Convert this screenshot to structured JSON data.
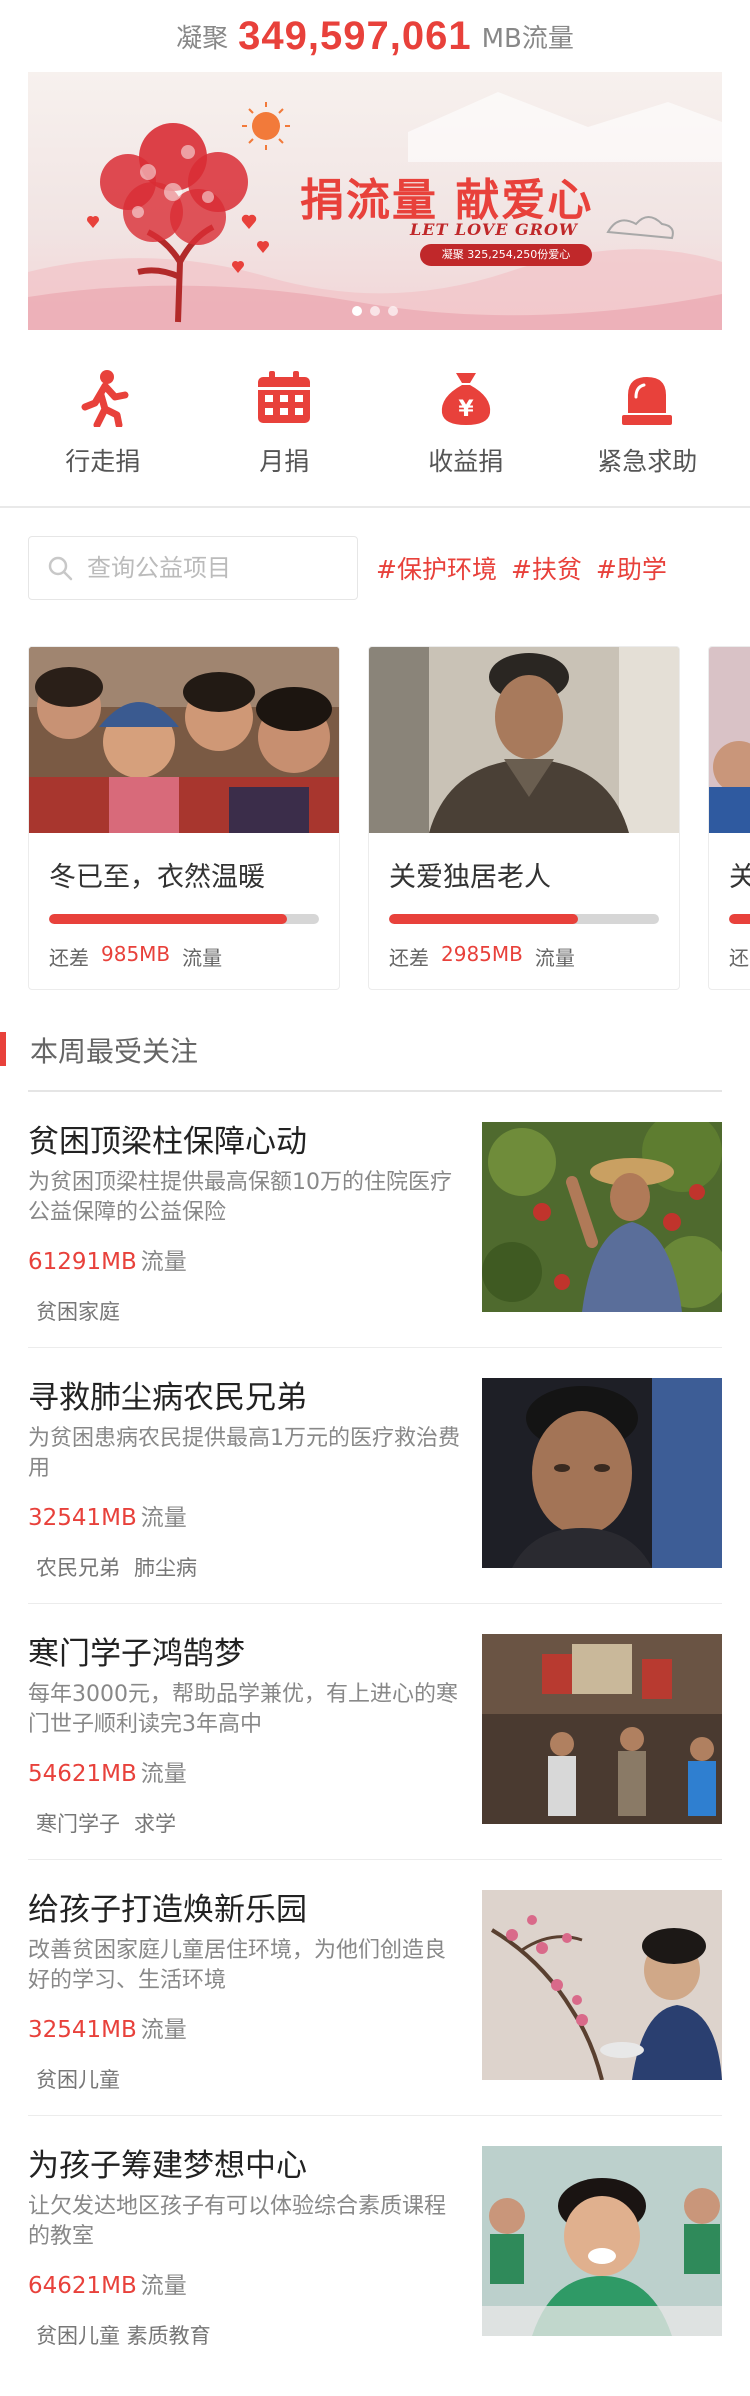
{
  "header": {
    "prefix": "凝聚",
    "total": "349,597,061",
    "unit": "MB流量"
  },
  "banner": {
    "title": "捐流量 献爱心",
    "subtitle": "LET LOVE GROW",
    "pill": "凝聚 325,254,250份爱心",
    "slide_count": 3,
    "active_slide": 1
  },
  "categories": [
    {
      "label": "行走捐",
      "icon": "walking-person-icon"
    },
    {
      "label": "月捐",
      "icon": "calendar-icon"
    },
    {
      "label": "收益捐",
      "icon": "money-bag-icon"
    },
    {
      "label": "紧急求助",
      "icon": "alarm-light-icon"
    }
  ],
  "search": {
    "placeholder": "查询公益项目"
  },
  "hot_tags": [
    "#保护环境",
    "#扶贫",
    "#助学"
  ],
  "featured": [
    {
      "title": "冬已至，衣然温暖",
      "progress": 0.88,
      "prefix": "还差",
      "amount": "985MB",
      "unit": "流量"
    },
    {
      "title": "关爱独居老人",
      "progress": 0.7,
      "prefix": "还差",
      "amount": "2985MB",
      "unit": "流量"
    },
    {
      "title": "关",
      "progress": 0.5,
      "prefix": "还",
      "amount": "",
      "unit": ""
    }
  ],
  "section": {
    "title": "本周最受关注"
  },
  "projects": [
    {
      "title": "贫困顶梁柱保障心动",
      "desc": "为贫困顶梁柱提供最高保额10万的住院医疗公益保障的公益保险",
      "amount": "61291MB",
      "unit": "流量",
      "tags": [
        "贫困家庭"
      ]
    },
    {
      "title": "寻救肺尘病农民兄弟",
      "desc": "为贫困患病农民提供最高1万元的医疗救治费用",
      "amount": "32541MB",
      "unit": "流量",
      "tags": [
        "农民兄弟",
        "肺尘病"
      ]
    },
    {
      "title": "寒门学子鸿鹄梦",
      "desc": "每年3000元，帮助品学兼优，有上进心的寒门世子顺利读完3年高中",
      "amount": "54621MB",
      "unit": "流量",
      "tags": [
        "寒门学子",
        "求学"
      ]
    },
    {
      "title": "给孩子打造焕新乐园",
      "desc": "改善贫困家庭儿童居住环境，为他们创造良好的学习、生活环境",
      "amount": "32541MB",
      "unit": "流量",
      "tags": [
        "贫困儿童"
      ]
    },
    {
      "title": "为孩子筹建梦想中心",
      "desc": "让欠发达地区孩子有可以体验综合素质课程的教室",
      "amount": "64621MB",
      "unit": "流量",
      "tags": [
        "贫困儿童 素质教育"
      ]
    }
  ],
  "colors": {
    "accent": "#e8413b",
    "text": "#333333",
    "muted": "#888888"
  }
}
